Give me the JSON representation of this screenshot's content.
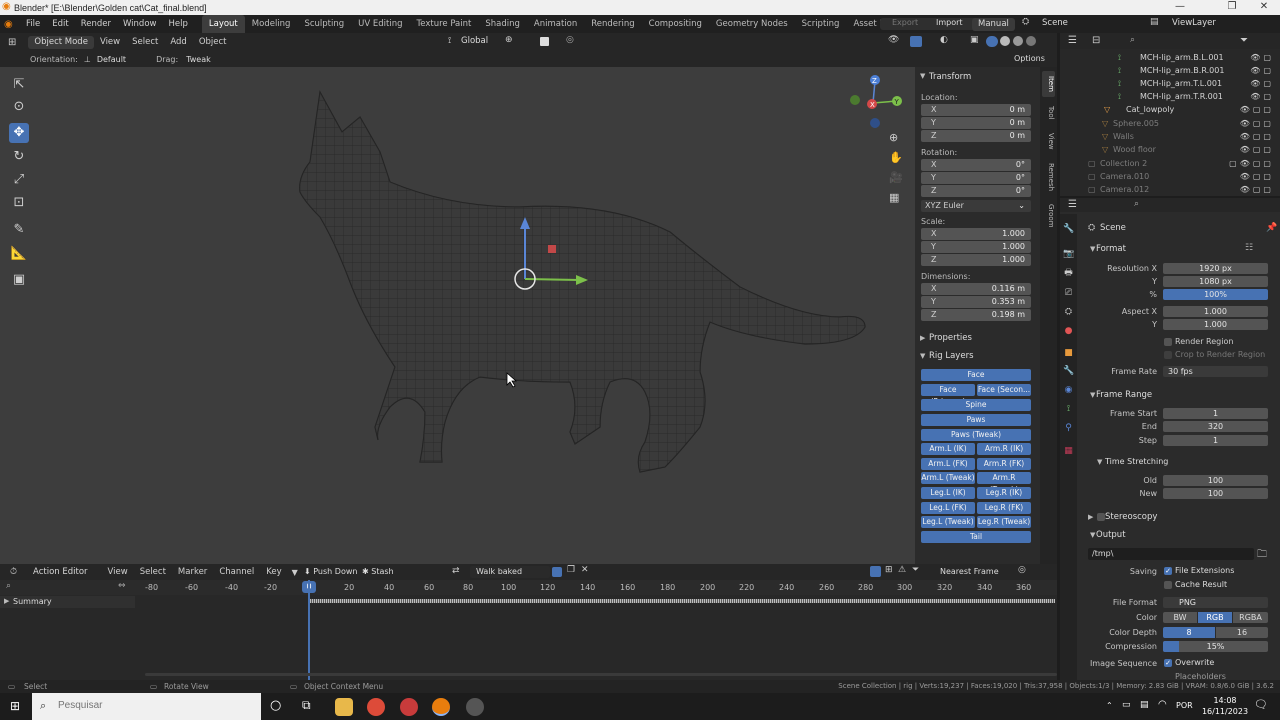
{
  "window": {
    "title": "Blender* [E:\\Blender\\Golden cat\\Cat_final.blend]",
    "minimize": "—",
    "maximize": "❐",
    "close": "✕"
  },
  "menu": [
    "File",
    "Edit",
    "Render",
    "Window",
    "Help"
  ],
  "workspaces": [
    "Layout",
    "Modeling",
    "Sculpting",
    "UV Editing",
    "Texture Paint",
    "Shading",
    "Animation",
    "Rendering",
    "Compositing",
    "Geometry Nodes",
    "Scripting",
    "Asset Browser"
  ],
  "add_workspace": "+",
  "topright": {
    "export": "Export",
    "import": "Import",
    "manual": "Manual",
    "scene": "Scene",
    "viewlayer": "ViewLayer"
  },
  "viewport_header": {
    "mode": "Object Mode",
    "menus": [
      "View",
      "Select",
      "Add",
      "Object"
    ],
    "transform": "Global"
  },
  "tool_settings": {
    "orientation_label": "Orientation:",
    "orientation": "Default",
    "drag_label": "Drag:",
    "drag": "Tweak",
    "options": "Options"
  },
  "npanel": {
    "transform_title": "Transform",
    "location_label": "Location:",
    "location": [
      {
        "axis": "X",
        "value": "0 m"
      },
      {
        "axis": "Y",
        "value": "0 m"
      },
      {
        "axis": "Z",
        "value": "0 m"
      }
    ],
    "rotation_label": "Rotation:",
    "rotation": [
      {
        "axis": "X",
        "value": "0°"
      },
      {
        "axis": "Y",
        "value": "0°"
      },
      {
        "axis": "Z",
        "value": "0°"
      }
    ],
    "rotation_mode": "XYZ Euler",
    "scale_label": "Scale:",
    "scale": [
      {
        "axis": "X",
        "value": "1.000"
      },
      {
        "axis": "Y",
        "value": "1.000"
      },
      {
        "axis": "Z",
        "value": "1.000"
      }
    ],
    "dimensions_label": "Dimensions:",
    "dimensions": [
      {
        "axis": "X",
        "value": "0.116 m"
      },
      {
        "axis": "Y",
        "value": "0.353 m"
      },
      {
        "axis": "Z",
        "value": "0.198 m"
      }
    ],
    "properties_title": "Properties",
    "rig_layers_title": "Rig Layers",
    "rig": {
      "face": "Face",
      "face_primary": "Face (Primary)",
      "face_secondary": "Face (Secon...",
      "spine": "Spine",
      "paws": "Paws",
      "paws_tweak": "Paws (Tweak)",
      "arm_l_ik": "Arm.L (IK)",
      "arm_r_ik": "Arm.R (IK)",
      "arm_l_fk": "Arm.L (FK)",
      "arm_r_fk": "Arm.R (FK)",
      "arm_l_tweak": "Arm.L (Tweak)",
      "arm_r_tweak": "Arm.R (Tweak)",
      "leg_l_ik": "Leg.L (IK)",
      "leg_r_ik": "Leg.R (IK)",
      "leg_l_fk": "Leg.L (FK)",
      "leg_r_fk": "Leg.R (FK)",
      "leg_l_tweak": "Leg.L (Tweak)",
      "leg_r_tweak": "Leg.R (Tweak)",
      "tail": "Tail"
    },
    "tabs": [
      "Item",
      "Tool",
      "View",
      "Remesh",
      "Groom"
    ]
  },
  "outliner": {
    "rows": [
      {
        "name": "MCH-lip_arm.B.L.001",
        "dim": false
      },
      {
        "name": "MCH-lip_arm.B.R.001",
        "dim": false
      },
      {
        "name": "MCH-lip_arm.T.L.001",
        "dim": false
      },
      {
        "name": "MCH-lip_arm.T.R.001",
        "dim": false
      },
      {
        "name": "Cat_lowpoly",
        "dim": false
      },
      {
        "name": "Sphere.005",
        "dim": true
      },
      {
        "name": "Walls",
        "dim": true
      },
      {
        "name": "Wood floor",
        "dim": true
      },
      {
        "name": "Collection 2",
        "dim": true
      },
      {
        "name": "Camera.010",
        "dim": true
      },
      {
        "name": "Camera.012",
        "dim": true
      }
    ]
  },
  "properties": {
    "context": "Scene",
    "format_title": "Format",
    "resolution_x_label": "Resolution X",
    "resolution_x": "1920 px",
    "resolution_y_label": "Y",
    "resolution_y": "1080 px",
    "resolution_pct_label": "%",
    "resolution_pct": "100%",
    "aspect_x_label": "Aspect X",
    "aspect_x": "1.000",
    "aspect_y_label": "Y",
    "aspect_y": "1.000",
    "render_region": "Render Region",
    "crop_region": "Crop to Render Region",
    "frame_rate_label": "Frame Rate",
    "frame_rate": "30 fps",
    "frame_range_title": "Frame Range",
    "frame_start_label": "Frame Start",
    "frame_start": "1",
    "end_label": "End",
    "end": "320",
    "step_label": "Step",
    "step": "1",
    "time_stretching_title": "Time Stretching",
    "old_label": "Old",
    "old": "100",
    "new_label": "New",
    "new": "100",
    "stereoscopy_title": "Stereoscopy",
    "output_title": "Output",
    "output_path": "/tmp\\",
    "saving_label": "Saving",
    "file_extensions": "File Extensions",
    "cache_result": "Cache Result",
    "file_format_label": "File Format",
    "file_format": "PNG",
    "color_label": "Color",
    "color_bw": "BW",
    "color_rgb": "RGB",
    "color_rgba": "RGBA",
    "color_depth_label": "Color Depth",
    "depth_8": "8",
    "depth_16": "16",
    "compression_label": "Compression",
    "compression": "15%",
    "compression_fraction": 0.15,
    "image_sequence_label": "Image Sequence",
    "overwrite": "Overwrite",
    "placeholders": "Placeholders"
  },
  "timeline": {
    "editor": "Action Editor",
    "menus": [
      "View",
      "Select",
      "Marker",
      "Channel",
      "Key"
    ],
    "push_down": "Push Down",
    "stash": "Stash",
    "action": "Walk baked",
    "interpolation": "Nearest Frame",
    "current_frame": "0",
    "ticks": [
      "-80",
      "-60",
      "-40",
      "-20",
      "0",
      "20",
      "40",
      "60",
      "80",
      "100",
      "120",
      "140",
      "160",
      "180",
      "200",
      "220",
      "240",
      "260",
      "280",
      "300",
      "320",
      "340",
      "360"
    ],
    "summary": "Summary"
  },
  "status": {
    "select": "Select",
    "rotate": "Rotate View",
    "context": "Object Context Menu",
    "stats": "Scene Collection | rig | Verts:19,237 | Faces:19,020 | Tris:37,958 | Objects:1/3 | Memory: 2.83 GiB | VRAM: 0.8/6.0 GiB | 3.6.2"
  },
  "taskbar": {
    "search": "Pesquisar",
    "lang": "POR",
    "time": "14:08",
    "date": "16/11/2023"
  },
  "colors": {
    "accent": "#4772b3",
    "viewport_bg": "#3d3d3d",
    "panel_bg": "#2b2b2b"
  }
}
